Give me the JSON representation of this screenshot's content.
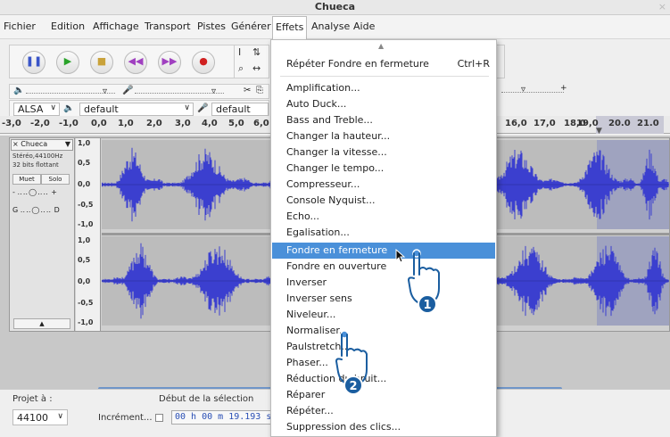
{
  "window": {
    "title": "Chueca"
  },
  "menubar": {
    "items": [
      {
        "label": "Fichier"
      },
      {
        "label": "Edition"
      },
      {
        "label": "Affichage"
      },
      {
        "label": "Transport"
      },
      {
        "label": "Pistes"
      },
      {
        "label": "Générer"
      },
      {
        "label": "Effets"
      },
      {
        "label": "Analyse"
      },
      {
        "label": "Aide"
      }
    ]
  },
  "toolbar": {
    "transport_icons": [
      "pause-icon",
      "play-icon",
      "stop-icon",
      "skip-start-icon",
      "skip-end-icon",
      "record-icon"
    ],
    "device_host": "ALSA",
    "playback_device": "default",
    "record_device": "default"
  },
  "ruler": {
    "ticks": [
      "-3,0",
      "-2,0",
      "-1,0",
      "0,0",
      "1,0",
      "2,0",
      "3,0",
      "4,0",
      "5,0",
      "6,0",
      "16,0",
      "17,0",
      "18,0",
      "19,0",
      "20.0",
      "21.0"
    ]
  },
  "track": {
    "name": "Chueca",
    "info1": "Stéréo,44100Hz",
    "info2": "32 bits flottant",
    "mute": "Muet",
    "solo": "Solo",
    "gain_left": "-",
    "gain_right": "+",
    "pan_left": "G",
    "pan_right": "D",
    "scale": [
      "1,0",
      "0,5",
      "0,0",
      "-0,5",
      "-1,0"
    ],
    "collapse_icon": "collapse-arrow-icon"
  },
  "status": {
    "project_rate_label": "Projet à :",
    "project_rate": "44100",
    "selection_start_label": "Début de la sélection",
    "snap_label": "Incrément...",
    "selection_start_value": "00 h 00 m 19.193 s"
  },
  "effects_menu": {
    "repeat": {
      "label": "Répéter Fondre en fermeture",
      "shortcut": "Ctrl+R"
    },
    "items": [
      "Amplification...",
      "Auto Duck...",
      "Bass and Treble...",
      "Changer la hauteur...",
      "Changer la vitesse...",
      "Changer le tempo...",
      "Compresseur...",
      "Console Nyquist...",
      "Echo...",
      "Egalisation...",
      "Fondre en fermeture",
      "Fondre en ouverture",
      "Inverser",
      "Inverser sens",
      "Niveleur...",
      "Normaliser...",
      "Paulstretch...",
      "Phaser...",
      "Réduction du bruit...",
      "Réparer",
      "Répéter...",
      "Suppression des clics..."
    ],
    "highlighted": "Fondre en fermeture"
  },
  "callouts": [
    {
      "number": "1"
    },
    {
      "number": "2"
    }
  ],
  "colors": {
    "highlight": "#4a90d9",
    "waveform": "#3b3fcf",
    "selection": "#9fa3bf",
    "badge": "#1b5ea0"
  }
}
